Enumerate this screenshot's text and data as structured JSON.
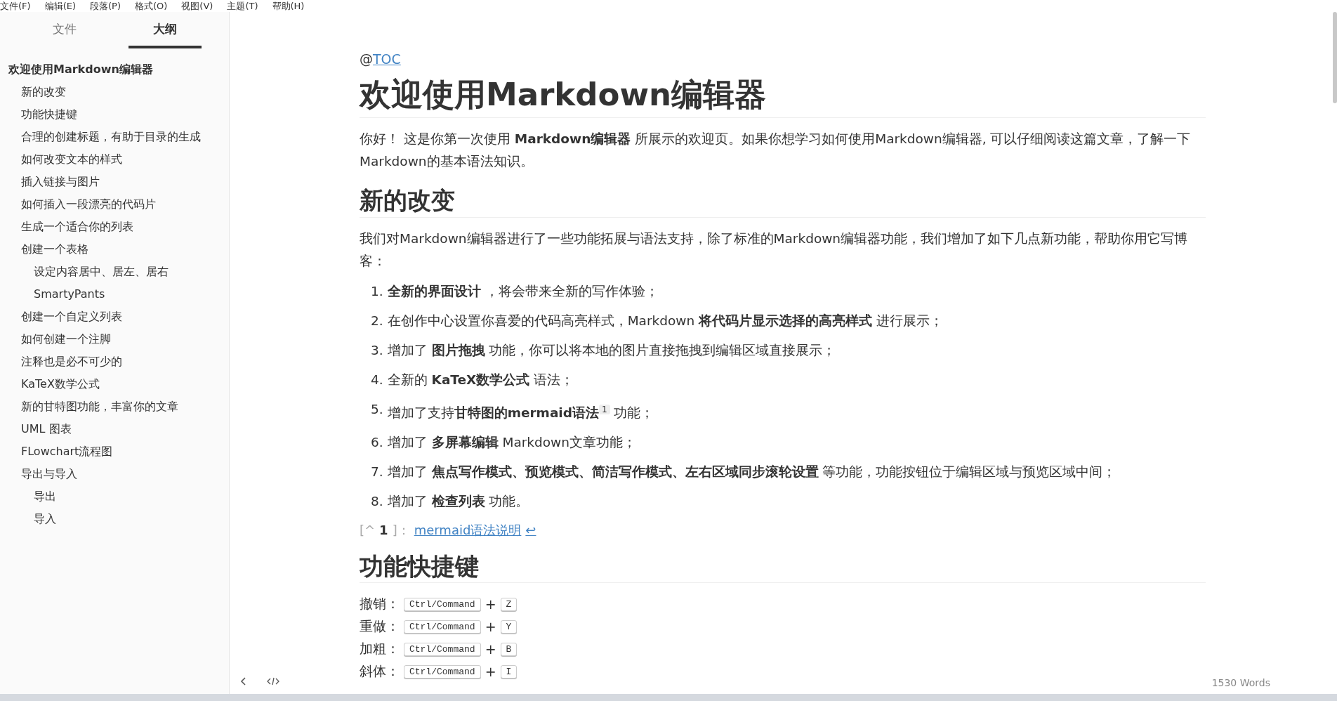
{
  "menu_bar": [
    "文件(F)",
    "编辑(E)",
    "段落(P)",
    "格式(O)",
    "视图(V)",
    "主题(T)",
    "帮助(H)"
  ],
  "sidebar": {
    "tabs": [
      {
        "label": "文件",
        "selected": false
      },
      {
        "label": "大纲",
        "selected": true
      }
    ],
    "outline": [
      {
        "label": "欢迎使用Markdown编辑器",
        "children": [
          {
            "label": "新的改变"
          },
          {
            "label": "功能快捷键"
          },
          {
            "label": "合理的创建标题，有助于目录的生成"
          },
          {
            "label": "如何改变文本的样式"
          },
          {
            "label": "插入链接与图片"
          },
          {
            "label": "如何插入一段漂亮的代码片"
          },
          {
            "label": "生成一个适合你的列表"
          },
          {
            "label": "创建一个表格",
            "children": [
              {
                "label": "设定内容居中、居左、居右"
              },
              {
                "label": "SmartyPants"
              }
            ]
          },
          {
            "label": "创建一个自定义列表"
          },
          {
            "label": "如何创建一个注脚"
          },
          {
            "label": "注释也是必不可少的"
          },
          {
            "label": "KaTeX数学公式"
          },
          {
            "label": "新的甘特图功能，丰富你的文章"
          },
          {
            "label": "UML 图表"
          },
          {
            "label": "FLowchart流程图"
          },
          {
            "label": "导出与导入",
            "children": [
              {
                "label": "导出"
              },
              {
                "label": "导入"
              }
            ]
          }
        ]
      }
    ]
  },
  "document": {
    "toc": {
      "prefix": "@",
      "link": "TOC"
    },
    "title": "欢迎使用Markdown编辑器",
    "intro": "你好！ 这是你第一次使用 **Markdown编辑器** 所展示的欢迎页。如果你想学习如何使用Markdown编辑器, 可以仔细阅读这篇文章，了解一下Markdown的基本语法知识。",
    "section_1": "新的改变",
    "section_1_text": "我们对Markdown编辑器进行了一些功能拓展与语法支持，除了标准的Markdown编辑器功能，我们增加了如下几点新功能，帮助你用它写博客：",
    "list": [
      {
        "number": "1.",
        "text": "**全新的界面设计** ，将会带来全新的写作体验；"
      },
      {
        "number": "2.",
        "text": "在创作中心设置你喜爱的代码高亮样式，Markdown **将代码片显示选择的高亮样式** 进行展示；"
      },
      {
        "number": "3.",
        "text": "增加了 **图片拖拽** 功能，你可以将本地的图片直接拖拽到编辑区域直接展示；"
      },
      {
        "number": "4.",
        "text": "全新的 **KaTeX数学公式** 语法；"
      },
      {
        "number": "5.",
        "text": "增加了支持**甘特图的mermaid语法**$^{1}$ 功能；"
      },
      {
        "number": "6.",
        "text": "增加了 **多屏幕编辑** Markdown文章功能；"
      },
      {
        "number": "7.",
        "text": "增加了 **焦点写作模式、预览模式、简洁写作模式、左右区域同步滚轮设置** 等功能，功能按钮位于编辑区域与预览区域中间；"
      },
      {
        "number": "8.",
        "text": "增加了 **检查列表** 功能。"
      }
    ],
    "footnote": {
      "open": "[^",
      "number": "1",
      "close": "]：",
      "link": "mermaid语法说明",
      "back": "↩"
    },
    "section_2": "功能快捷键",
    "shortcuts": [
      {
        "label": "撤销：",
        "keys": [
          "Ctrl/Command",
          "Z"
        ],
        "joiner": "+"
      },
      {
        "label": "重做：",
        "keys": [
          "Ctrl/Command",
          "Y"
        ],
        "joiner": "+"
      },
      {
        "label": "加粗：",
        "keys": [
          "Ctrl/Command",
          "B"
        ],
        "joiner": "+"
      },
      {
        "label": "斜体：",
        "keys": [
          "Ctrl/Command",
          "I"
        ],
        "joiner": "+"
      }
    ]
  },
  "footer": {
    "word_count": "1530 Words"
  }
}
